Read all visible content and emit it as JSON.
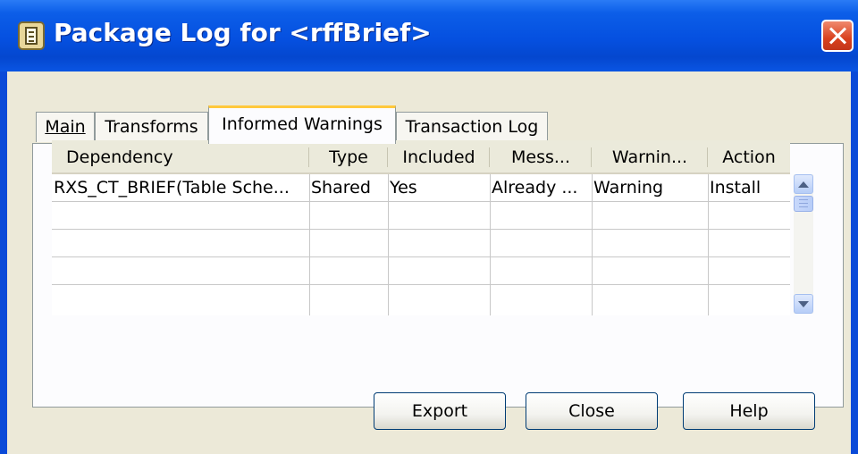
{
  "window": {
    "title": "Package Log for <rffBrief>"
  },
  "tabs": [
    {
      "label": "Main",
      "active": false
    },
    {
      "label": "Transforms",
      "active": false
    },
    {
      "label": "Informed Warnings",
      "active": true
    },
    {
      "label": "Transaction Log",
      "active": false
    }
  ],
  "table": {
    "columns": [
      "Dependency",
      "Type",
      "Included",
      "Mess...",
      "Warnin...",
      "Action"
    ],
    "rows": [
      [
        "RXS_CT_BRIEF(Table Sche...",
        "Shared",
        "Yes",
        "Already ...",
        "Warning",
        "Install"
      ],
      [
        "",
        "",
        "",
        "",
        "",
        ""
      ],
      [
        "",
        "",
        "",
        "",
        "",
        ""
      ],
      [
        "",
        "",
        "",
        "",
        "",
        ""
      ],
      [
        "",
        "",
        "",
        "",
        "",
        ""
      ]
    ]
  },
  "buttons": {
    "export": "Export",
    "close": "Close",
    "help": "Help"
  },
  "colors": {
    "titlebar": "#0550e0",
    "dialog_bg": "#ece9d8",
    "active_tab_accent": "#ffc83c",
    "close_button": "#d9411e"
  },
  "icons": {
    "app": "package-log-icon",
    "close": "close-icon",
    "scroll_up": "chevron-up-icon",
    "scroll_down": "chevron-down-icon"
  }
}
